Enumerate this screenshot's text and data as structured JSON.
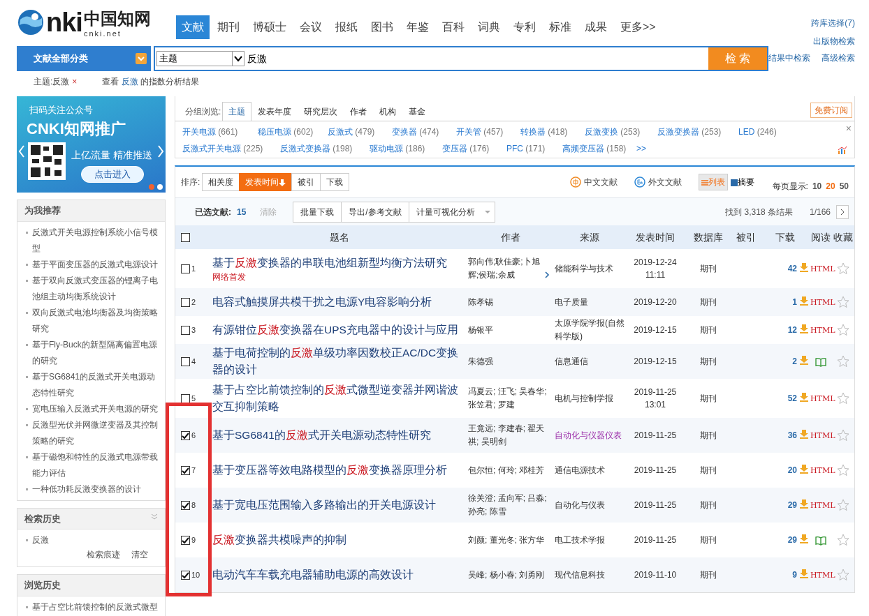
{
  "logo": {
    "brand": "nki",
    "cn_name": "中国知网",
    "domain": "cnki.net"
  },
  "nav_tabs": [
    {
      "label": "文献",
      "selected": true
    },
    {
      "label": "期刊",
      "selected": false
    },
    {
      "label": "博硕士",
      "selected": false
    },
    {
      "label": "会议",
      "selected": false
    },
    {
      "label": "报纸",
      "selected": false
    },
    {
      "label": "图书",
      "selected": false
    },
    {
      "label": "年鉴",
      "selected": false
    },
    {
      "label": "百科",
      "selected": false
    },
    {
      "label": "词典",
      "selected": false
    },
    {
      "label": "专利",
      "selected": false
    },
    {
      "label": "标准",
      "selected": false
    },
    {
      "label": "成果",
      "selected": false
    },
    {
      "label": "更多>>",
      "selected": false
    }
  ],
  "top_links": [
    "跨库选择(7)",
    "出版物检索",
    "结果中检索",
    "高级检索"
  ],
  "search": {
    "category": "文献全部分类",
    "field": "主题",
    "value": "反激",
    "button": "检 索"
  },
  "breadcrumb": {
    "term": "主题:反激",
    "remove": "×",
    "index_before": "查看 ",
    "index_term": "反激",
    "index_after": " 的指数分析结果"
  },
  "banner": {
    "line1": "扫码关注公众号",
    "headline": "CNKI知网推广",
    "slogan": "上亿流量 精准推送",
    "button": "点击进入",
    "dots": [
      {
        "selected": true
      },
      {
        "selected": false
      }
    ]
  },
  "recommend": {
    "title": "为我推荐",
    "items": [
      "反激式开关电源控制系统小信号模型",
      "基于平面变压器的反激式电源设计",
      "基于双向反激式变压器的锂离子电池组主动均衡系统设计",
      "双向反激式电池均衡器及均衡策略研究",
      "基于Fly-Buck的新型隔离偏置电源的研究",
      "基于SG6841的反激式开关电源动态特性研究",
      "宽电压输入反激式开关电源的研究",
      "反激型光伏并网微逆变器及其控制策略的研究",
      "基于磁饱和特性的反激式电源带载能力评估",
      "一种低功耗反激变换器的设计"
    ]
  },
  "search_history": {
    "title": "检索历史",
    "items": [
      "反激"
    ],
    "links": [
      "检索痕迹",
      "清空"
    ]
  },
  "browse_history": {
    "title": "浏览历史",
    "items": [
      "基于占空比前馈控制的反激式微型"
    ]
  },
  "group_browse": {
    "label": "分组浏览:",
    "tabs": [
      {
        "label": "主题",
        "selected": true
      },
      {
        "label": "发表年度",
        "selected": false
      },
      {
        "label": "研究层次",
        "selected": false
      },
      {
        "label": "作者",
        "selected": false
      },
      {
        "label": "机构",
        "selected": false
      },
      {
        "label": "基金",
        "selected": false
      }
    ],
    "subscribe": "免费订阅",
    "more": ">>",
    "close": "×",
    "tags": [
      {
        "name": "开关电源",
        "count": "(661)"
      },
      {
        "name": "稳压电源",
        "count": "(602)"
      },
      {
        "name": "反激式",
        "count": "(479)"
      },
      {
        "name": "变换器",
        "count": "(474)"
      },
      {
        "name": "开关管",
        "count": "(457)"
      },
      {
        "name": "转换器",
        "count": "(418)"
      },
      {
        "name": "反激变换",
        "count": "(253)"
      },
      {
        "name": "反激变换器",
        "count": "(253)"
      },
      {
        "name": "LED",
        "count": "(246)"
      },
      {
        "name": "反激式开关电源",
        "count": "(225)"
      },
      {
        "name": "反激式变换器",
        "count": "(198)"
      },
      {
        "name": "驱动电源",
        "count": "(186)"
      },
      {
        "name": "变压器",
        "count": "(176)"
      },
      {
        "name": "PFC",
        "count": "(171)"
      },
      {
        "name": "高频变压器",
        "count": "(158)"
      }
    ]
  },
  "sort": {
    "label": "排序:",
    "options": [
      {
        "label": "相关度",
        "selected": false
      },
      {
        "label": "发表时间",
        "selected": true
      },
      {
        "label": "被引",
        "selected": false
      },
      {
        "label": "下载",
        "selected": false
      }
    ]
  },
  "lang_filters": [
    {
      "kind": "zh",
      "label": "中文文献"
    },
    {
      "kind": "en",
      "label": "外文文献"
    }
  ],
  "views": [
    {
      "label": "列表",
      "selected": true
    },
    {
      "label": "摘要",
      "selected": false
    }
  ],
  "page_size": {
    "label": "每页显示:",
    "options": [
      {
        "label": "10",
        "selected": false
      },
      {
        "label": "20",
        "selected": true
      },
      {
        "label": "50",
        "selected": false
      }
    ]
  },
  "selection": {
    "label": "已选文献:",
    "count": "15",
    "clear": "清除",
    "actions": [
      "批量下载",
      "导出/参考文献",
      "计量可视化分析"
    ]
  },
  "results": {
    "summary": "找到 3,318 条结果",
    "pages": "1/166"
  },
  "highlight_frame": true,
  "table": {
    "select_all": false,
    "columns": [
      "题名",
      "作者",
      "来源",
      "发表时间",
      "数据库",
      "被引",
      "下载",
      "阅读",
      "收藏"
    ],
    "rows": [
      {
        "checked": false,
        "index": "1",
        "title": [
          {
            "text": "基于"
          },
          {
            "text": "反激",
            "hit": true
          },
          {
            "text": "变换器的串联电池组新型均衡方法研究"
          }
        ],
        "tag": "网络首发",
        "authors": "郭向伟;耿佳豪;卜旭辉;侯瑞;余威",
        "more_authors": true,
        "source": "储能科学与技术",
        "visited": false,
        "date": "2019-12-24",
        "time": "11:11",
        "database": "期刊",
        "downloads": "42",
        "read": {
          "kind": "html",
          "label": "HTML"
        },
        "favorite": false
      },
      {
        "checked": false,
        "index": "2",
        "title": [
          {
            "text": "电容式触摸屏共模干扰之电源Y电容影响分析"
          }
        ],
        "authors": "陈孝锡",
        "more_authors": false,
        "source": "电子质量",
        "visited": false,
        "date": "2019-12-20",
        "database": "期刊",
        "downloads": "1",
        "read": {
          "kind": "html",
          "label": "HTML"
        },
        "favorite": false
      },
      {
        "checked": false,
        "index": "3",
        "title": [
          {
            "text": "有源钳位"
          },
          {
            "text": "反激",
            "hit": true
          },
          {
            "text": "变换器在UPS充电器中的设计与应用"
          }
        ],
        "authors": "杨银平",
        "more_authors": false,
        "source": "太原学院学报(自然科学版)",
        "visited": false,
        "date": "2019-12-15",
        "database": "期刊",
        "downloads": "12",
        "read": {
          "kind": "html",
          "label": "HTML"
        },
        "favorite": false
      },
      {
        "checked": false,
        "index": "4",
        "title": [
          {
            "text": "基于电荷控制的"
          },
          {
            "text": "反激",
            "hit": true
          },
          {
            "text": "单级功率因数校正AC/DC变换器的设计"
          }
        ],
        "authors": "朱德强",
        "more_authors": false,
        "source": "信息通信",
        "visited": false,
        "date": "2019-12-15",
        "database": "期刊",
        "downloads": "2",
        "read": {
          "kind": "book"
        },
        "favorite": false
      },
      {
        "checked": false,
        "index": "5",
        "title": [
          {
            "text": "基于占空比前馈控制的"
          },
          {
            "text": "反激",
            "hit": true
          },
          {
            "text": "式微型逆变器并网谐波交互抑制策略"
          }
        ],
        "authors": "冯夏云; 汪飞; 吴春华; 张笠君; 罗建",
        "more_authors": false,
        "source": "电机与控制学报",
        "visited": false,
        "date": "2019-11-25",
        "time": "13:01",
        "database": "期刊",
        "downloads": "52",
        "read": {
          "kind": "html",
          "label": "HTML"
        },
        "favorite": false
      },
      {
        "checked": true,
        "index": "6",
        "title": [
          {
            "text": "基于SG6841的"
          },
          {
            "text": "反激",
            "hit": true
          },
          {
            "text": "式开关电源动态特性研究"
          }
        ],
        "authors": "王竟远; 李建春; 翟天祺; 吴明剑",
        "more_authors": false,
        "source": "自动化与仪器仪表",
        "visited": true,
        "date": "2019-11-25",
        "database": "期刊",
        "downloads": "36",
        "read": {
          "kind": "html",
          "label": "HTML"
        },
        "favorite": false
      },
      {
        "checked": true,
        "index": "7",
        "title": [
          {
            "text": "基于变压器等效电路模型的"
          },
          {
            "text": "反激",
            "hit": true
          },
          {
            "text": "变换器原理分析"
          }
        ],
        "authors": "包尔恒; 何玲; 邓桂芳",
        "more_authors": false,
        "source": "通信电源技术",
        "visited": false,
        "date": "2019-11-25",
        "database": "期刊",
        "downloads": "20",
        "read": {
          "kind": "html",
          "label": "HTML"
        },
        "favorite": false
      },
      {
        "checked": true,
        "index": "8",
        "title": [
          {
            "text": "基于宽电压范围输入多路输出的开关电源设计"
          }
        ],
        "authors": "徐关澄; 孟向军; 吕淼; 孙亮; 陈雪",
        "more_authors": false,
        "source": "自动化与仪表",
        "visited": false,
        "date": "2019-11-25",
        "database": "期刊",
        "downloads": "29",
        "read": {
          "kind": "html",
          "label": "HTML"
        },
        "favorite": false
      },
      {
        "checked": true,
        "index": "9",
        "title": [
          {
            "text": "反激",
            "hit": true
          },
          {
            "text": "变换器共模噪声的抑制"
          }
        ],
        "authors": "刘颜; 董光冬; 张方华",
        "more_authors": false,
        "source": "电工技术学报",
        "visited": false,
        "date": "2019-11-25",
        "database": "期刊",
        "downloads": "29",
        "read": {
          "kind": "book"
        },
        "favorite": false
      },
      {
        "checked": true,
        "index": "10",
        "title": [
          {
            "text": "电动汽车车载充电器辅助电源的高效设计"
          }
        ],
        "authors": "吴峰; 杨小春; 刘勇刚",
        "more_authors": false,
        "source": "现代信息科技",
        "visited": false,
        "date": "2019-11-10",
        "database": "期刊",
        "downloads": "9",
        "read": {
          "kind": "html",
          "label": "HTML"
        },
        "favorite": false
      }
    ]
  }
}
